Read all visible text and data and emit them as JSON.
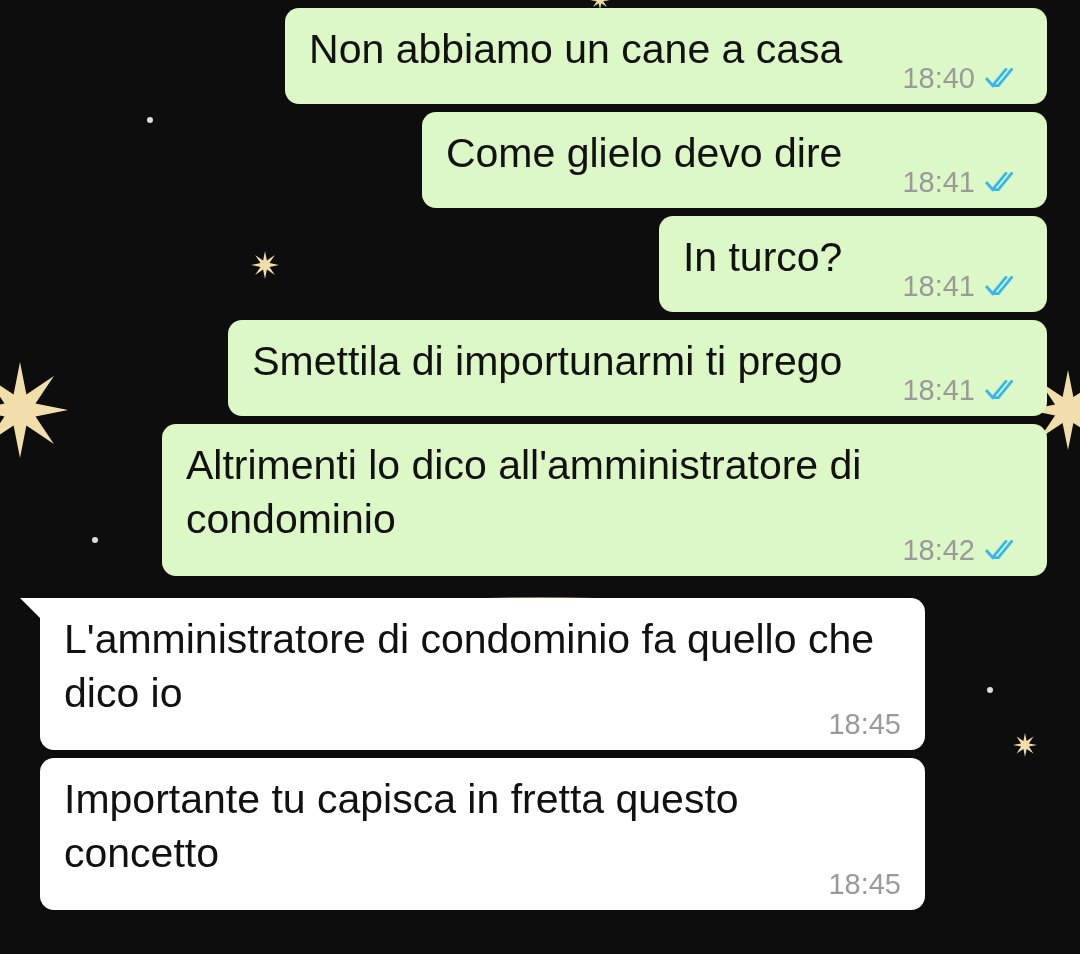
{
  "messages": [
    {
      "kind": "out",
      "text": "Non abbiamo un cane a casa",
      "time": "18:40",
      "read": true,
      "tail": false
    },
    {
      "kind": "out",
      "text": "Come glielo devo dire",
      "time": "18:41",
      "read": true,
      "tail": false
    },
    {
      "kind": "out",
      "text": "In turco?",
      "time": "18:41",
      "read": true,
      "tail": false
    },
    {
      "kind": "out",
      "text": "Smettila di importunarmi ti prego",
      "time": "18:41",
      "read": true,
      "tail": false
    },
    {
      "kind": "out",
      "text": "Altrimenti lo dico all'amministratore di condominio",
      "time": "18:42",
      "read": true,
      "tail": false
    },
    {
      "kind": "in",
      "text": "L'amministratore di condominio fa quello che dico io",
      "time": "18:45",
      "tail": true
    },
    {
      "kind": "in",
      "text": "Importante tu capisca in fretta questo concetto",
      "time": "18:45",
      "tail": false
    }
  ]
}
